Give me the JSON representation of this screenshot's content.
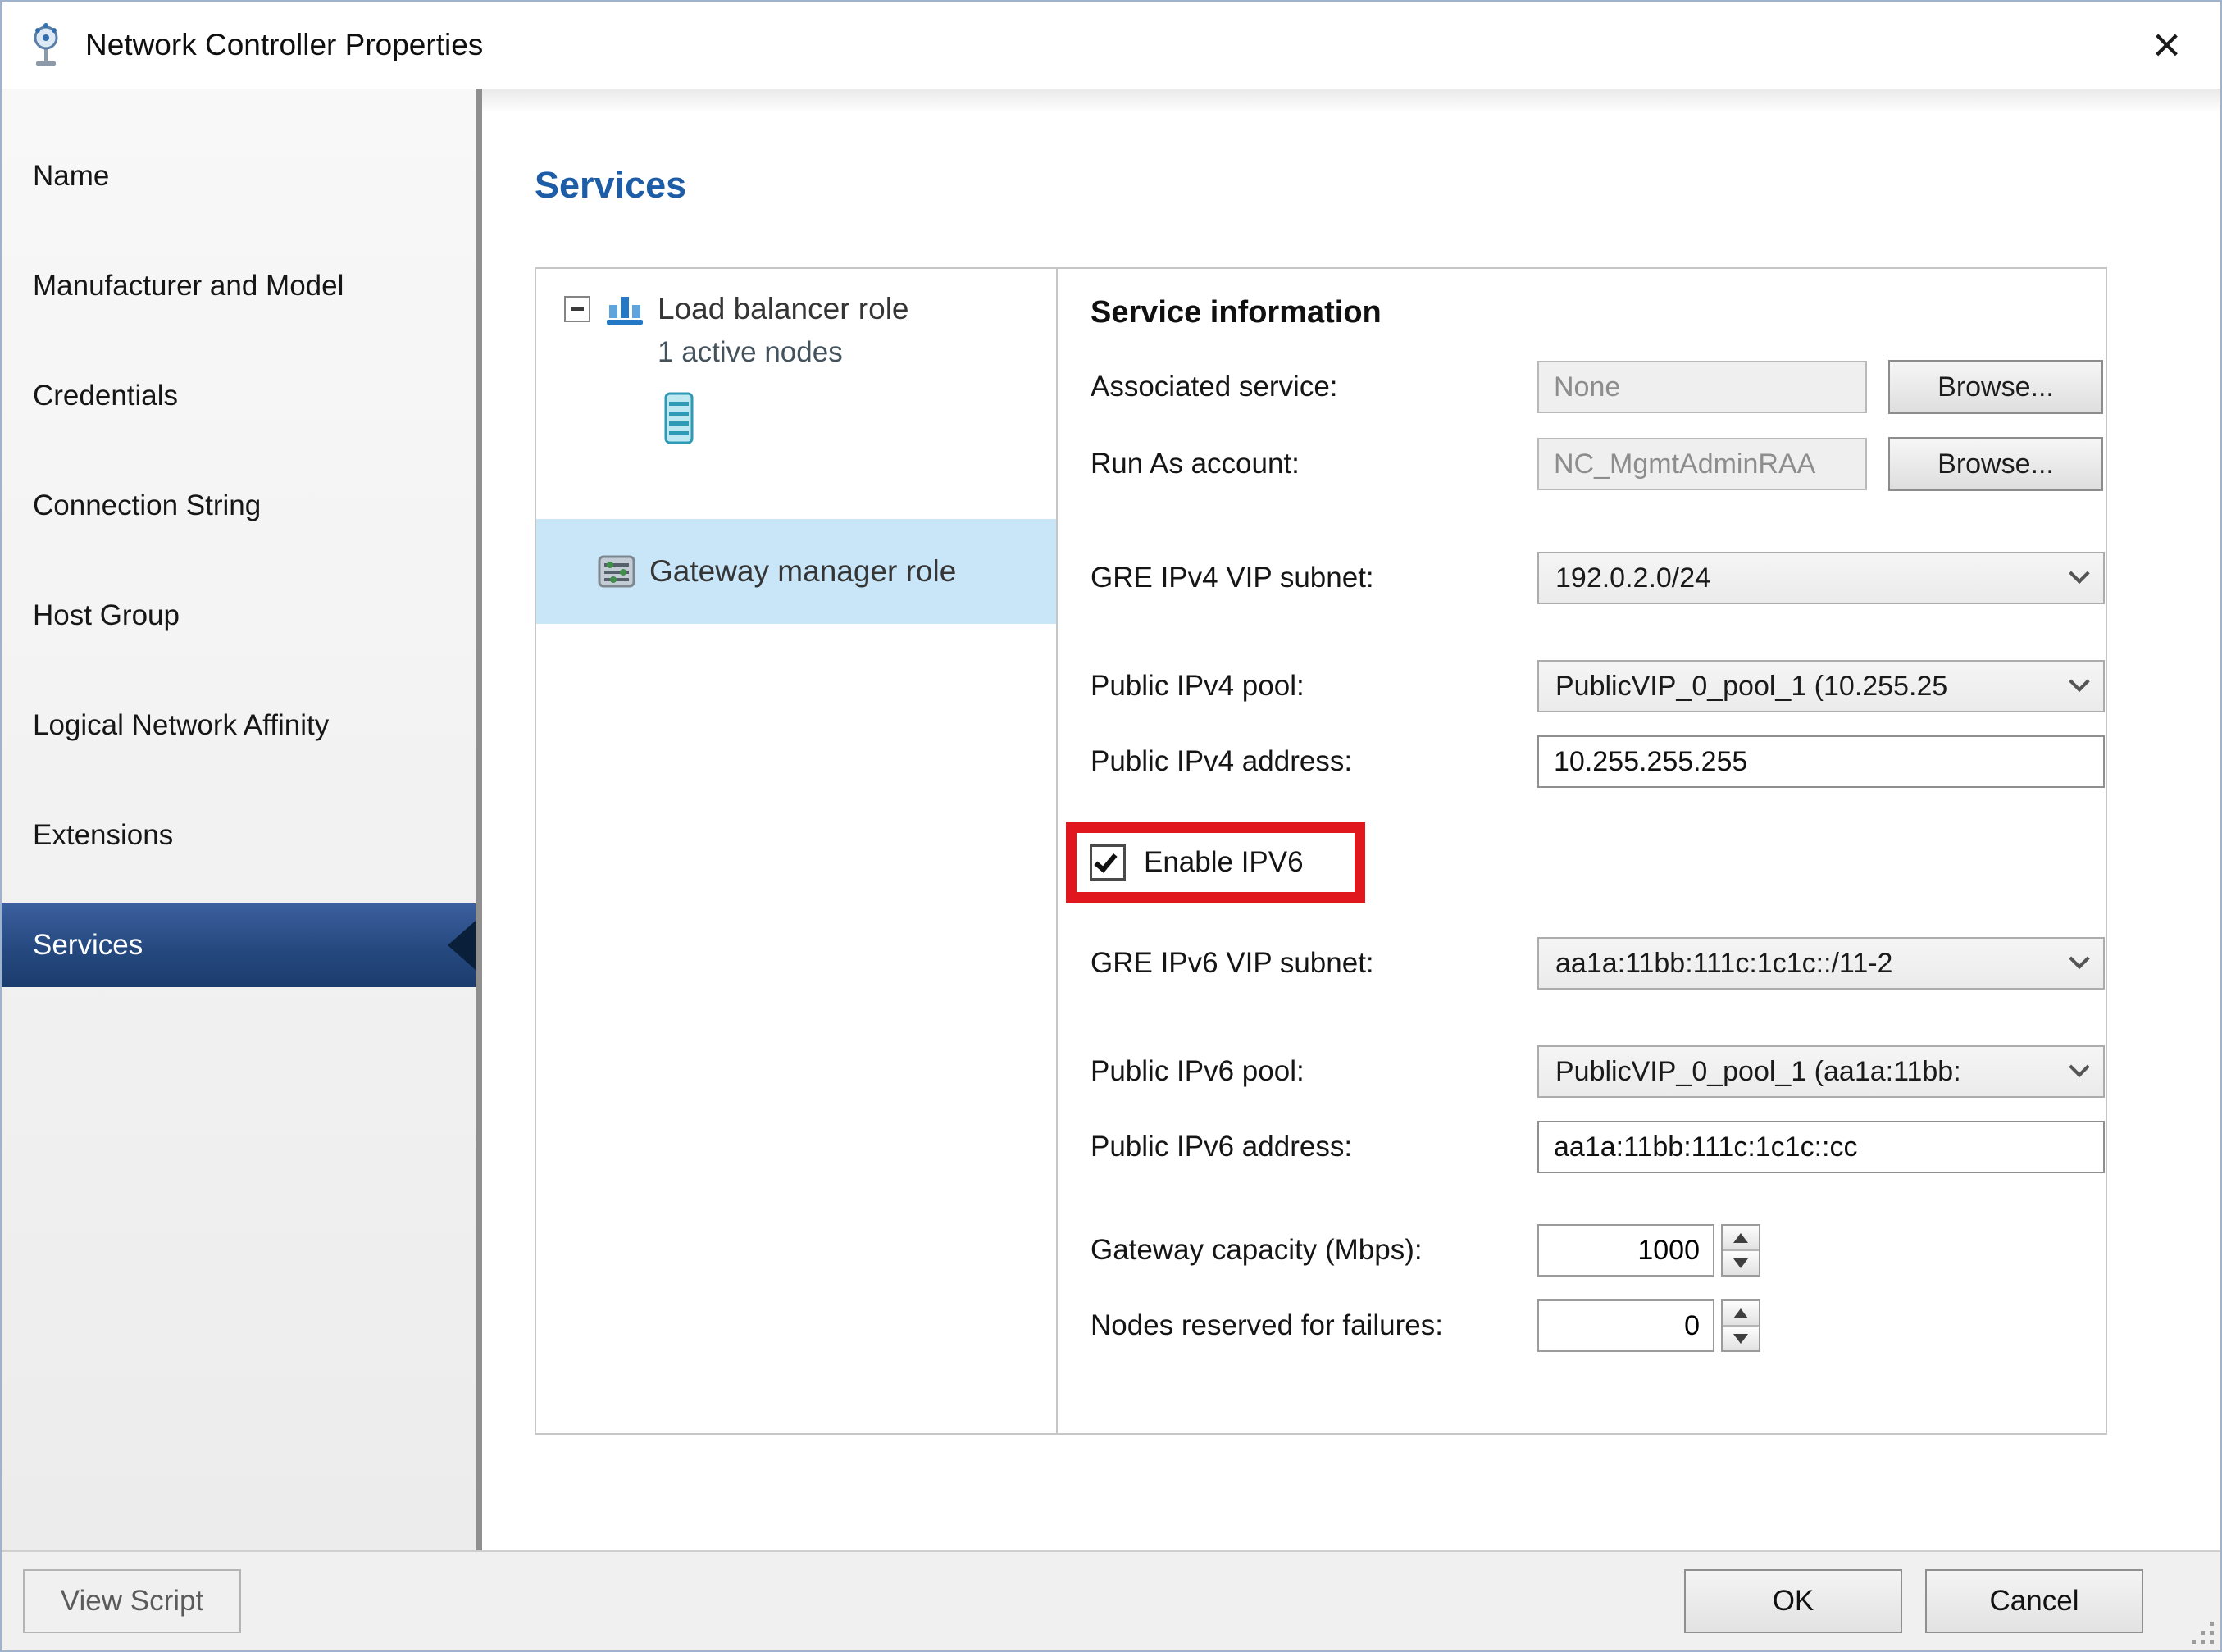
{
  "window": {
    "title": "Network Controller Properties",
    "close_glyph": "×"
  },
  "sidebar": {
    "items": [
      {
        "label": "Name",
        "selected": false
      },
      {
        "label": "Manufacturer and Model",
        "selected": false
      },
      {
        "label": "Credentials",
        "selected": false
      },
      {
        "label": "Connection String",
        "selected": false
      },
      {
        "label": "Host Group",
        "selected": false
      },
      {
        "label": "Logical Network Affinity",
        "selected": false
      },
      {
        "label": "Extensions",
        "selected": false
      },
      {
        "label": "Services",
        "selected": true
      }
    ]
  },
  "main": {
    "heading": "Services",
    "tree": {
      "load_balancer_label": "Load balancer role",
      "load_balancer_sub": "1 active nodes",
      "gateway_label": "Gateway manager role"
    },
    "form": {
      "section_title": "Service information",
      "associated_service_label": "Associated service:",
      "associated_service_value": "None",
      "associated_browse_label": "Browse...",
      "run_as_label": "Run As account:",
      "run_as_value": "NC_MgmtAdminRAA",
      "run_as_browse_label": "Browse...",
      "gre_ipv4_label": "GRE IPv4 VIP subnet:",
      "gre_ipv4_value": "192.0.2.0/24",
      "public_ipv4_pool_label": "Public IPv4 pool:",
      "public_ipv4_pool_value": "PublicVIP_0_pool_1 (10.255.25",
      "public_ipv4_address_label": "Public IPv4 address:",
      "public_ipv4_address_value": "10.255.255.255",
      "enable_ipv6_label": "Enable IPV6",
      "enable_ipv6_checked": true,
      "gre_ipv6_label": "GRE IPv6 VIP subnet:",
      "gre_ipv6_value": "aa1a:11bb:111c:1c1c::/11-2",
      "public_ipv6_pool_label": "Public IPv6 pool:",
      "public_ipv6_pool_value": "PublicVIP_0_pool_1 (aa1a:11bb:",
      "public_ipv6_address_label": "Public IPv6 address:",
      "public_ipv6_address_value": "aa1a:11bb:111c:1c1c::cc",
      "gateway_capacity_label": "Gateway capacity (Mbps):",
      "gateway_capacity_value": "1000",
      "nodes_reserved_label": "Nodes reserved for failures:",
      "nodes_reserved_value": "0"
    }
  },
  "footer": {
    "view_script_label": "View Script",
    "ok_label": "OK",
    "cancel_label": "Cancel"
  },
  "colors": {
    "accent_blue": "#1d5ca6",
    "nav_selected": "#25497f",
    "tree_selection": "#c8e6f8",
    "annotation_red": "#e0181e"
  }
}
